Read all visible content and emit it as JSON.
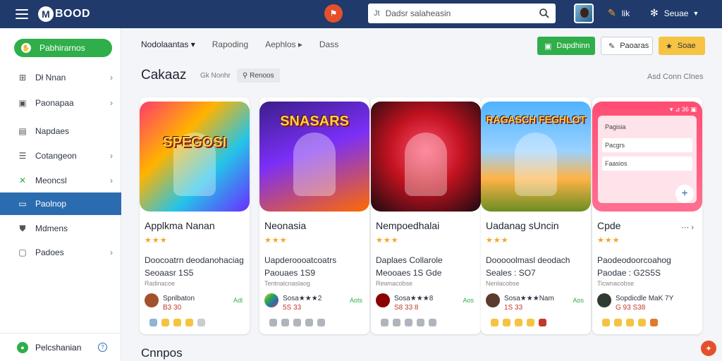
{
  "header": {
    "logo_mark": "M",
    "logo_text": "BOOD",
    "center_icon": "⚑",
    "search_prefix": "Jt",
    "search_placeholder": "Dadsr salaheasin",
    "util_label": "lik",
    "account_label": "Seuae"
  },
  "sidebar": {
    "primary_button": "Pabhirarnos",
    "items": [
      {
        "label": "Dł Nnan",
        "icon": "grid-icon",
        "glyph": "⊞",
        "chevron": true
      },
      {
        "label": "Paonapaa",
        "icon": "folder-icon",
        "glyph": "▣",
        "chevron": true
      },
      {
        "label": "Napdaes",
        "icon": "box-icon",
        "glyph": "▤",
        "chevron": false
      },
      {
        "label": "Cotangeon",
        "icon": "list-icon",
        "glyph": "☰",
        "chevron": true
      },
      {
        "label": "Meoncsl",
        "icon": "tool-icon",
        "glyph": "✕",
        "chevron": true
      },
      {
        "label": "Paolnop",
        "icon": "card-icon",
        "glyph": "▭",
        "chevron": false
      },
      {
        "label": "Mdmens",
        "icon": "shield-icon",
        "glyph": "⛊",
        "chevron": false
      },
      {
        "label": "Padoes",
        "icon": "square-icon",
        "glyph": "▢",
        "chevron": true
      }
    ],
    "active_index": 5,
    "footer_label": "Pelcshanian"
  },
  "filters": [
    {
      "label": "Nodolaantas ▾",
      "selected": true
    },
    {
      "label": "Rapoding",
      "selected": false
    },
    {
      "label": "Aephlos ▸",
      "selected": false
    },
    {
      "label": "Dass",
      "selected": false
    }
  ],
  "actions": {
    "primary": "Dapdhinn",
    "secondary": "Paoaras",
    "tertiary": "Soae"
  },
  "section": {
    "title": "Cakaaz",
    "subtitle": "Gk Nonhr",
    "tag": "Renoos",
    "link": "Asd Conn Clnes"
  },
  "cards": [
    {
      "name": "Applkma Nanan",
      "stars": "★★★",
      "line1": "Doocoatrn deodanohaciag",
      "line2": "Seoaasr 1S5",
      "line3": "Radinacoe",
      "dev_name": "Spnlbaton",
      "dev_value": "B3 30",
      "free": "Adl",
      "art_title": "SPEGOSI",
      "badges": [
        "#8fb3d9",
        "#f5c342",
        "#f5c342",
        "#f5c342",
        "#c8ccd3"
      ]
    },
    {
      "name": "Neonasia",
      "stars": "★★★",
      "line1": "Uapderoooatcoatrs",
      "line2": "Paouaes 1S9",
      "line3": "Tentnalcnaslaog",
      "dev_name": "Sosa★★★2",
      "dev_value": "5S 33",
      "free": "Aots",
      "art_title": "SNASARS",
      "badges": [
        "#b0b5bd",
        "#b0b5bd",
        "#b0b5bd",
        "#b0b5bd",
        "#b0b5bd"
      ]
    },
    {
      "name": "Nempoedhalai",
      "stars": "★★★",
      "line1": "Daplaes Collarole",
      "line2": "Meooaes 1S Gde",
      "line3": "Rewnacobse",
      "dev_name": "Sosa★★★8",
      "dev_value": "S8 33 8",
      "free": "Aos",
      "art_title": "",
      "badges": [
        "#b0b5bd",
        "#b0b5bd",
        "#b0b5bd",
        "#b0b5bd",
        "#b0b5bd"
      ]
    },
    {
      "name": "Uadanag sUncin",
      "stars": "★★★",
      "line1": "Dooooolmasl deodach",
      "line2": "Seales : SO7",
      "line3": "Nenlacobse",
      "dev_name": "Sosa★★★Nam",
      "dev_value": "1S 33",
      "free": "Aos",
      "art_title": "RAGASCH FEGHLOT",
      "badges": [
        "#f5c342",
        "#f5c342",
        "#f5c342",
        "#f5c342",
        "#c0392b"
      ]
    },
    {
      "name": "Cpde",
      "stars": "★★★",
      "line1": "Paodeodoorcoahog",
      "line2": "Paodae : G2S5S",
      "line3": "Ticwnacobse",
      "dev_name": "Sopdicdle MaK 7Y",
      "dev_value": "G 93 S38",
      "free": "",
      "art_title": "",
      "badges": [
        "#f5c342",
        "#f5c342",
        "#f5c342",
        "#f5c342",
        "#e07a2c"
      ]
    }
  ],
  "card5_form": {
    "status": "▾ ⊿ 36 ▣",
    "field1": "Pagisia",
    "field2": "Pacgrs",
    "field3": "Faasios"
  },
  "bottom_title": "Cnnpos",
  "colors": {
    "topbar": "#1f3a6b",
    "accent_green": "#2fae4a",
    "active_blue": "#2b6cb0",
    "accent_yellow": "#f6c343",
    "accent_orange": "#e4502c"
  }
}
